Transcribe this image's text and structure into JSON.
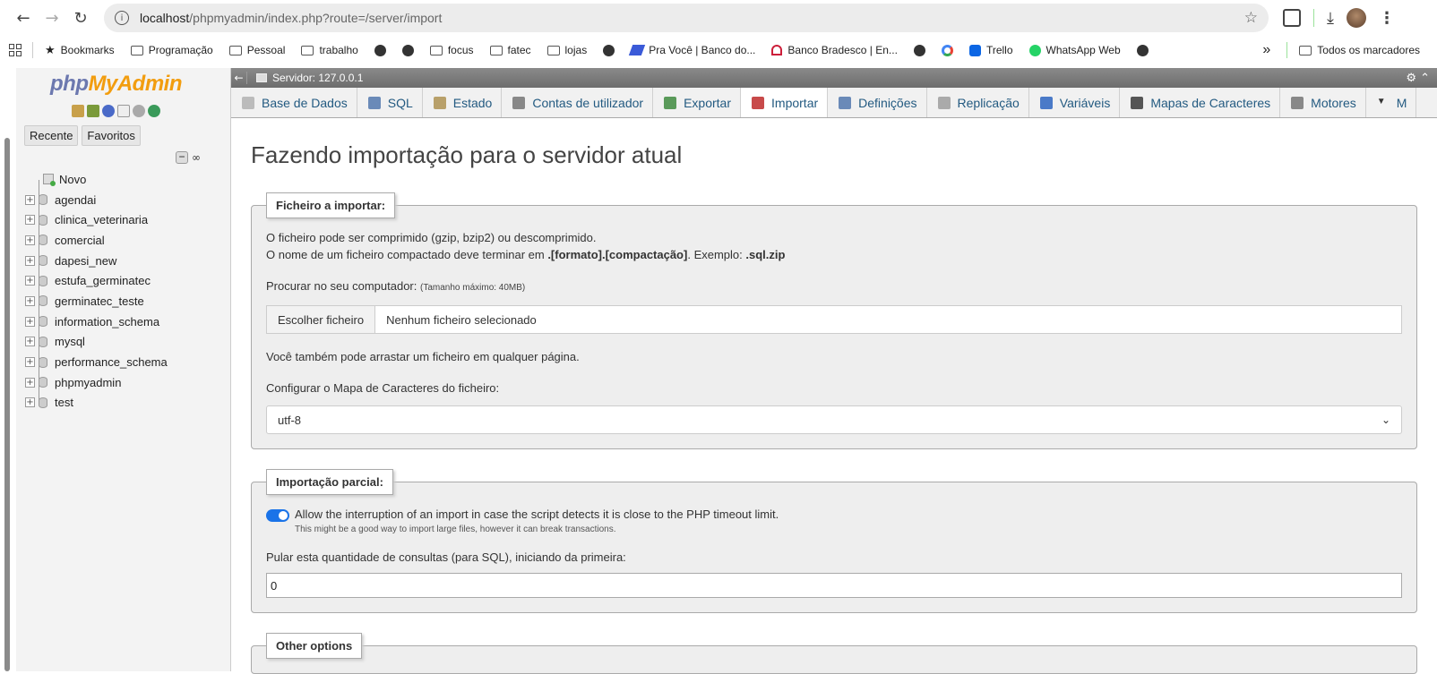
{
  "browser": {
    "url_host": "localhost",
    "url_path": "/phpmyadmin/index.php?route=/server/import"
  },
  "bookmarks": [
    {
      "label": "Bookmarks",
      "icon": "star-icon"
    },
    {
      "label": "Programação",
      "icon": "folder-icon"
    },
    {
      "label": "Pessoal",
      "icon": "folder-icon"
    },
    {
      "label": "trabalho",
      "icon": "folder-icon"
    },
    {
      "label": "",
      "icon": "globe-icon"
    },
    {
      "label": "",
      "icon": "globe-icon"
    },
    {
      "label": "focus",
      "icon": "folder-icon"
    },
    {
      "label": "fatec",
      "icon": "folder-icon"
    },
    {
      "label": "lojas",
      "icon": "folder-icon"
    },
    {
      "label": "",
      "icon": "globe-icon"
    },
    {
      "label": "Pra Você | Banco do...",
      "icon": "bb-icon"
    },
    {
      "label": "Banco Bradesco | En...",
      "icon": "bradesco-icon"
    },
    {
      "label": "",
      "icon": "globe-icon"
    },
    {
      "label": "",
      "icon": "google-icon"
    },
    {
      "label": "Trello",
      "icon": "trello-icon"
    },
    {
      "label": "WhatsApp Web",
      "icon": "whatsapp-icon"
    },
    {
      "label": "",
      "icon": "globe-icon"
    }
  ],
  "bookmarks_more": "»",
  "all_bookmarks": "Todos os marcadores",
  "sidebar": {
    "logo_php": "php",
    "logo_my": "My",
    "logo_admin": "Admin",
    "tab_recent": "Recente",
    "tab_favorites": "Favoritos",
    "new_label": "Novo",
    "databases": [
      "agendai",
      "clinica_veterinaria",
      "comercial",
      "dapesi_new",
      "estufa_germinatec",
      "germinatec_teste",
      "information_schema",
      "mysql",
      "performance_schema",
      "phpmyadmin",
      "test"
    ]
  },
  "server_bar": {
    "label": "Servidor: 127.0.0.1"
  },
  "tabs": [
    {
      "label": "Base de Dados",
      "icon": "database-icon"
    },
    {
      "label": "SQL",
      "icon": "sql-icon"
    },
    {
      "label": "Estado",
      "icon": "status-icon"
    },
    {
      "label": "Contas de utilizador",
      "icon": "users-icon"
    },
    {
      "label": "Exportar",
      "icon": "export-icon"
    },
    {
      "label": "Importar",
      "icon": "import-icon",
      "active": true
    },
    {
      "label": "Definições",
      "icon": "wrench-icon"
    },
    {
      "label": "Replicação",
      "icon": "replication-icon"
    },
    {
      "label": "Variáveis",
      "icon": "variables-icon"
    },
    {
      "label": "Mapas de Caracteres",
      "icon": "charset-icon"
    },
    {
      "label": "Motores",
      "icon": "engine-icon"
    },
    {
      "label": "M",
      "icon": "more-icon"
    }
  ],
  "page": {
    "title": "Fazendo importação para o servidor atual",
    "file_section": {
      "legend": "Ficheiro a importar:",
      "line1": "O ficheiro pode ser comprimido (gzip, bzip2) ou descomprimido.",
      "line2_pre": "O nome de um ficheiro compactado deve terminar em ",
      "line2_bold": ".[formato].[compactação]",
      "line2_mid": ". Exemplo: ",
      "line2_example": ".sql.zip",
      "browse_label": "Procurar no seu computador:",
      "max_size": "(Tamanho máximo: 40MB)",
      "choose_button": "Escolher ficheiro",
      "no_file": "Nenhum ficheiro selecionado",
      "drag_hint": "Você também pode arrastar um ficheiro em qualquer página.",
      "charset_label": "Configurar o Mapa de Caracteres do ficheiro:",
      "charset_value": "utf-8"
    },
    "partial_section": {
      "legend": "Importação parcial:",
      "allow_interrupt": "Allow the interruption of an import in case the script detects it is close to the PHP timeout limit.",
      "allow_interrupt_hint": "This might be a good way to import large files, however it can break transactions.",
      "skip_label": "Pular esta quantidade de consultas (para SQL), iniciando da primeira:",
      "skip_value": "0"
    },
    "other_section": {
      "legend": "Other options"
    }
  }
}
